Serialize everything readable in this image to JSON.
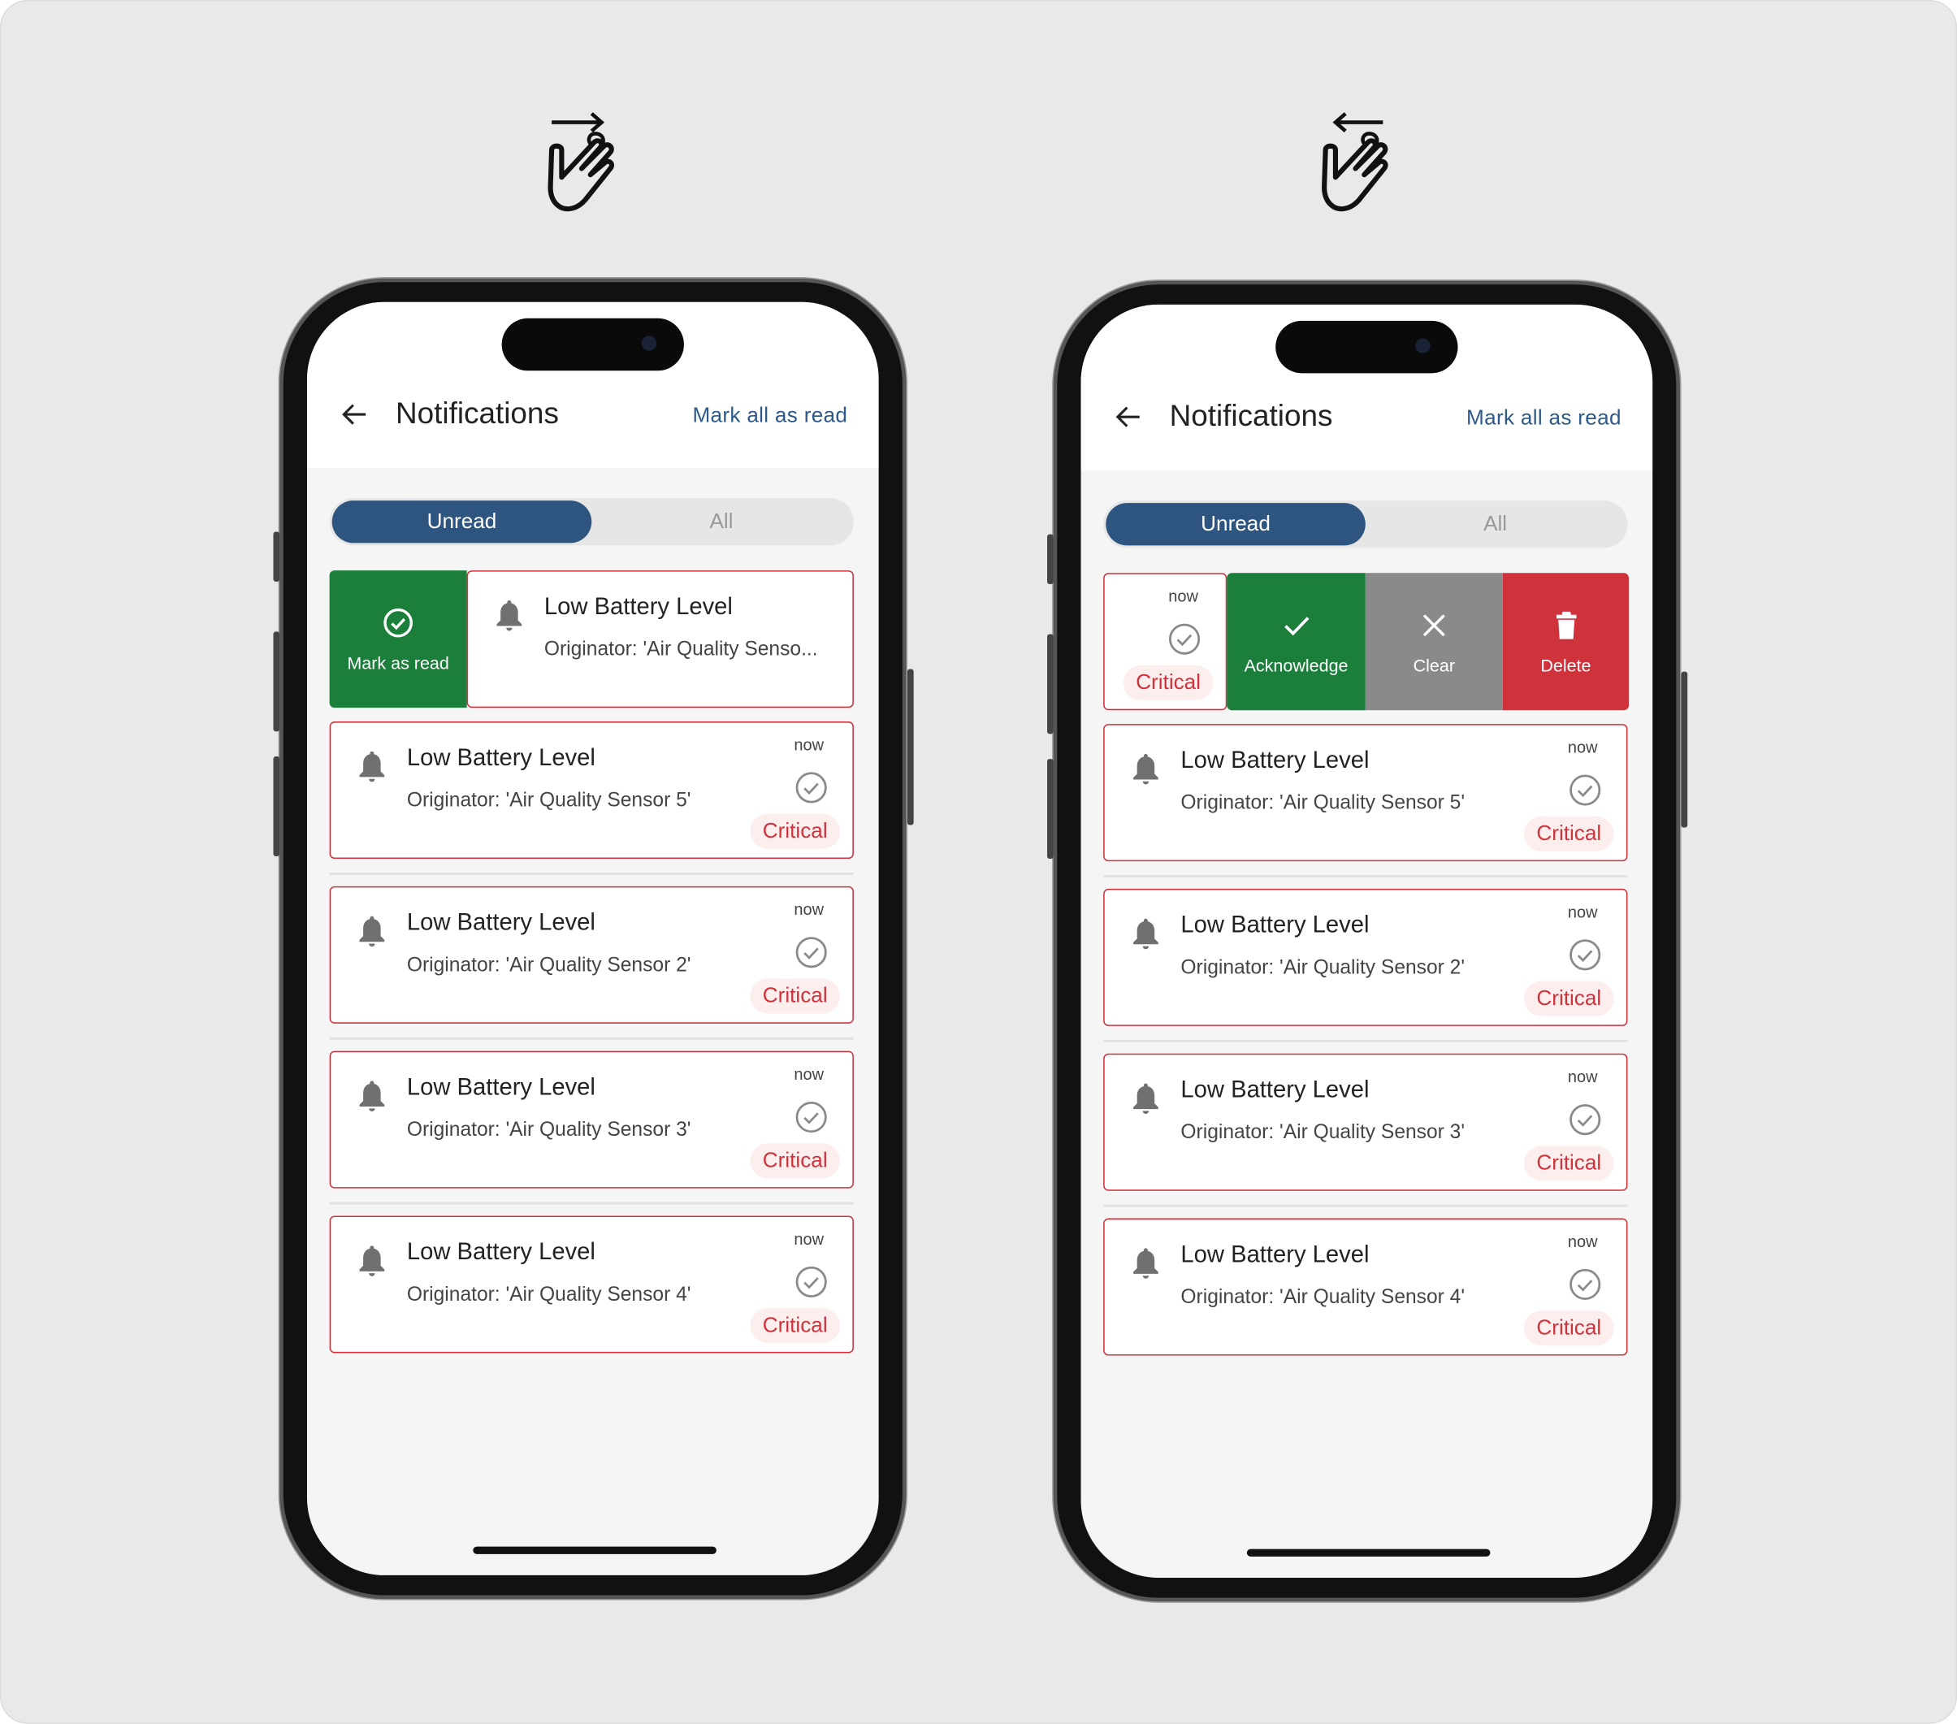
{
  "gestures": [
    {
      "icon": "swipe-right-hand-icon",
      "direction": "right"
    },
    {
      "icon": "swipe-left-hand-icon",
      "direction": "left"
    }
  ],
  "colors": {
    "primary": "#2d5580",
    "link": "#2d5a8a",
    "critical": "#d0323c",
    "acknowledge": "#1b7f3b",
    "clear": "#8a8a8a",
    "delete": "#d0323c"
  },
  "phones": [
    {
      "header": {
        "title": "Notifications",
        "mark_all": "Mark all as read"
      },
      "tabs": {
        "unread": "Unread",
        "all": "All",
        "selected": "Unread"
      },
      "swipe": {
        "type": "right",
        "action": "Mark as read",
        "title": "Low Battery Level",
        "subtitle": "Originator: 'Air Quality Senso..."
      },
      "cards": [
        {
          "title": "Low Battery Level",
          "subtitle": "Originator: 'Air Quality Sensor 5'",
          "time": "now",
          "severity": "Critical"
        },
        {
          "title": "Low Battery Level",
          "subtitle": "Originator: 'Air Quality Sensor 2'",
          "time": "now",
          "severity": "Critical"
        },
        {
          "title": "Low Battery Level",
          "subtitle": "Originator: 'Air Quality Sensor 3'",
          "time": "now",
          "severity": "Critical"
        },
        {
          "title": "Low Battery Level",
          "subtitle": "Originator: 'Air Quality Sensor 4'",
          "time": "now",
          "severity": "Critical"
        }
      ]
    },
    {
      "header": {
        "title": "Notifications",
        "mark_all": "Mark all as read"
      },
      "tabs": {
        "unread": "Unread",
        "all": "All",
        "selected": "Unread"
      },
      "swipe": {
        "type": "left",
        "time": "now",
        "severity": "Critical",
        "actions": [
          "Acknowledge",
          "Clear",
          "Delete"
        ]
      },
      "cards": [
        {
          "title": "Low Battery Level",
          "subtitle": "Originator: 'Air Quality Sensor 5'",
          "time": "now",
          "severity": "Critical"
        },
        {
          "title": "Low Battery Level",
          "subtitle": "Originator: 'Air Quality Sensor 2'",
          "time": "now",
          "severity": "Critical"
        },
        {
          "title": "Low Battery Level",
          "subtitle": "Originator: 'Air Quality Sensor 3'",
          "time": "now",
          "severity": "Critical"
        },
        {
          "title": "Low Battery Level",
          "subtitle": "Originator: 'Air Quality Sensor 4'",
          "time": "now",
          "severity": "Critical"
        }
      ]
    }
  ]
}
